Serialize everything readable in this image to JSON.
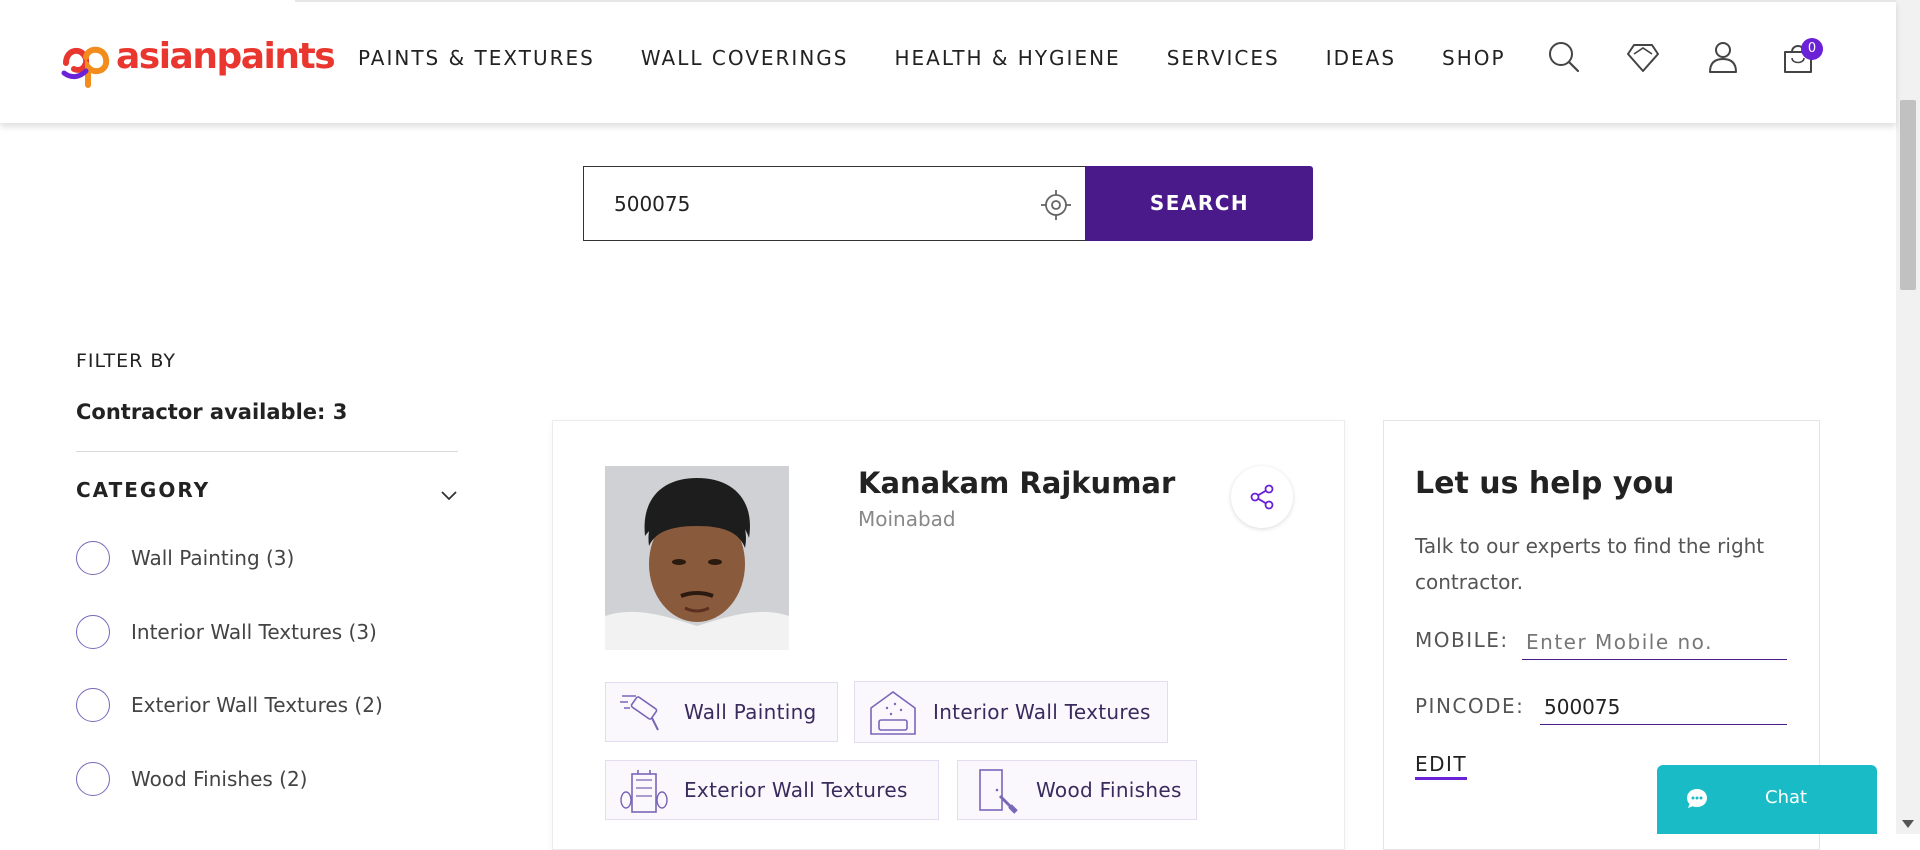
{
  "brand": {
    "logo_text": "asianpaints",
    "logo_color": "#e9362e"
  },
  "nav": {
    "items": [
      "PAINTS & TEXTURES",
      "WALL COVERINGS",
      "HEALTH & HYGIENE",
      "SERVICES",
      "IDEAS",
      "SHOP"
    ]
  },
  "header_icons": [
    "search-icon",
    "wishlist-icon",
    "account-icon",
    "cart-icon"
  ],
  "cart": {
    "count": "0"
  },
  "search": {
    "value": "500075",
    "button_label": "SEARCH"
  },
  "filter": {
    "title": "FILTER BY",
    "contractor_count": "Contractor available: 3",
    "category_title": "CATEGORY",
    "options": [
      "Wall Painting (3)",
      "Interior Wall Textures (3)",
      "Exterior Wall Textures (2)",
      "Wood Finishes (2)"
    ]
  },
  "contractor": {
    "name": "Kanakam Rajkumar",
    "location": "Moinabad",
    "services": [
      "Wall Painting",
      "Interior Wall Textures",
      "Exterior Wall Textures",
      "Wood Finishes"
    ]
  },
  "help": {
    "title": "Let us help you",
    "description": "Talk to our experts to find the right contractor.",
    "mobile_label": "MOBILE:",
    "mobile_placeholder": "Enter Mobile no.",
    "pincode_label": "PINCODE:",
    "pincode_value": "500075",
    "edit_label": "EDIT"
  },
  "chat": {
    "label": "Chat"
  },
  "colors": {
    "primary": "#4a1a8a",
    "accent": "#6b21d6",
    "chat": "#19bcc6"
  }
}
